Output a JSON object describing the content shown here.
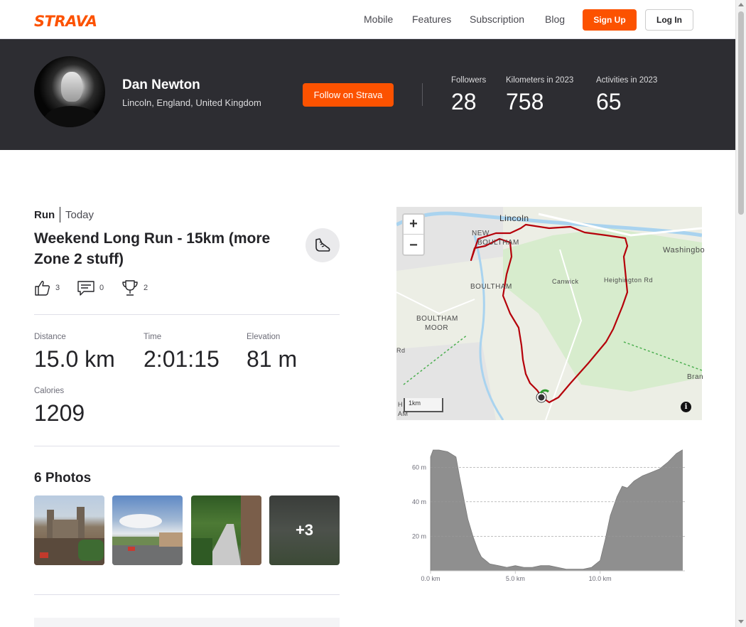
{
  "nav": {
    "logo": "STRAVA",
    "links": [
      "Mobile",
      "Features",
      "Subscription",
      "Blog"
    ],
    "signup": "Sign Up",
    "login": "Log In"
  },
  "athlete": {
    "name": "Dan Newton",
    "location": "Lincoln, England, United Kingdom",
    "follow_label": "Follow on Strava",
    "stats": [
      {
        "label": "Followers",
        "value": "28"
      },
      {
        "label": "Kilometers in 2023",
        "value": "758"
      },
      {
        "label": "Activities in 2023",
        "value": "65"
      }
    ]
  },
  "activity": {
    "type": "Run",
    "date": "Today",
    "title": "Weekend Long Run - 15km (more Zone 2 stuff)",
    "kudos": "3",
    "comments": "0",
    "achievements": "2",
    "metrics": [
      {
        "label": "Distance",
        "value": "15.0 km"
      },
      {
        "label": "Time",
        "value": "2:01:15"
      },
      {
        "label": "Elevation",
        "value": "81 m"
      },
      {
        "label": "Calories",
        "value": "1209"
      }
    ]
  },
  "photos": {
    "title": "6 Photos",
    "more_label": "+3"
  },
  "map": {
    "zoom_in": "+",
    "zoom_out": "−",
    "scale": "1km",
    "info": "i",
    "places": [
      "Lincoln",
      "NEW",
      "BOULTHAM",
      "BOULTHAM",
      "BOULTHAM",
      "MOOR",
      "Canwick",
      "Heighington Rd",
      "Washingbo",
      "Bran",
      "Rd",
      "H",
      "AM"
    ]
  },
  "chart_data": {
    "type": "area",
    "title": "",
    "xlabel": "",
    "ylabel": "",
    "x_ticks": [
      "0.0 km",
      "5.0 km",
      "10.0 km"
    ],
    "y_ticks": [
      "20 m",
      "40 m",
      "60 m"
    ],
    "xlim": [
      0,
      15
    ],
    "ylim": [
      0,
      70
    ],
    "grid": true,
    "x": [
      0,
      0.15,
      0.5,
      1.0,
      1.5,
      1.7,
      2.0,
      2.2,
      2.5,
      2.8,
      3.0,
      3.5,
      4.0,
      4.5,
      5.0,
      5.5,
      6.0,
      6.5,
      7.0,
      7.5,
      8.0,
      8.5,
      9.0,
      9.5,
      10.0,
      10.3,
      10.6,
      11.0,
      11.3,
      11.6,
      12.0,
      12.5,
      13.0,
      13.5,
      14.0,
      14.5,
      14.85
    ],
    "y": [
      66,
      70,
      70,
      69,
      66,
      55,
      40,
      30,
      20,
      12,
      8,
      4,
      3,
      2,
      3,
      2,
      2,
      3,
      3,
      2,
      1,
      1,
      1,
      2,
      6,
      18,
      32,
      43,
      49,
      48,
      52,
      55,
      57,
      59,
      63,
      68,
      70
    ]
  }
}
